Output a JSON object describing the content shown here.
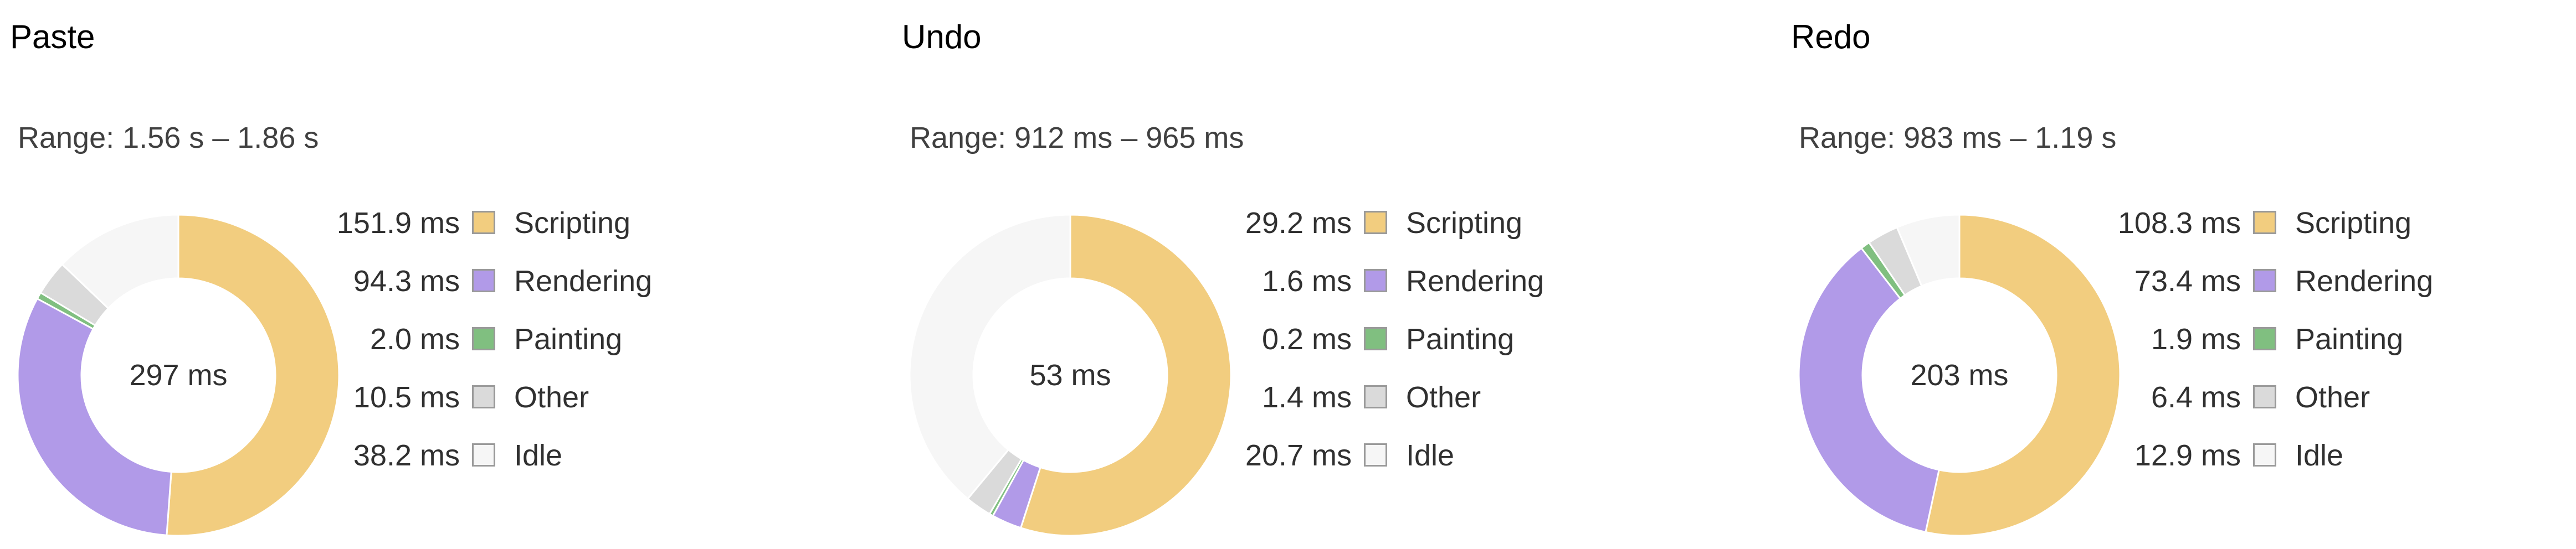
{
  "chart_data": [
    {
      "type": "pie",
      "title": "Paste",
      "range": "Range: 1.56 s – 1.86 s",
      "total": "297 ms",
      "categories": [
        "Scripting",
        "Rendering",
        "Painting",
        "Other",
        "Idle"
      ],
      "values": [
        151.9,
        94.3,
        2.0,
        10.5,
        38.2
      ],
      "value_labels": [
        "151.9 ms",
        "94.3 ms",
        "2.0 ms",
        "10.5 ms",
        "38.2 ms"
      ],
      "colors": [
        "#f2cd7f",
        "#b19ae8",
        "#80bf80",
        "#dadada",
        "#f6f6f6"
      ],
      "legend": "right"
    },
    {
      "type": "pie",
      "title": "Undo",
      "range": "Range: 912 ms – 965 ms",
      "total": "53 ms",
      "categories": [
        "Scripting",
        "Rendering",
        "Painting",
        "Other",
        "Idle"
      ],
      "values": [
        29.2,
        1.6,
        0.2,
        1.4,
        20.7
      ],
      "value_labels": [
        "29.2 ms",
        "1.6 ms",
        "0.2 ms",
        "1.4 ms",
        "20.7 ms"
      ],
      "colors": [
        "#f2cd7f",
        "#b19ae8",
        "#80bf80",
        "#dadada",
        "#f6f6f6"
      ],
      "legend": "right"
    },
    {
      "type": "pie",
      "title": "Redo",
      "range": "Range: 983 ms – 1.19 s",
      "total": "203 ms",
      "categories": [
        "Scripting",
        "Rendering",
        "Painting",
        "Other",
        "Idle"
      ],
      "values": [
        108.3,
        73.4,
        1.9,
        6.4,
        12.9
      ],
      "value_labels": [
        "108.3 ms",
        "73.4 ms",
        "1.9 ms",
        "6.4 ms",
        "12.9 ms"
      ],
      "colors": [
        "#f2cd7f",
        "#b19ae8",
        "#80bf80",
        "#dadada",
        "#f6f6f6"
      ],
      "legend": "right"
    }
  ]
}
